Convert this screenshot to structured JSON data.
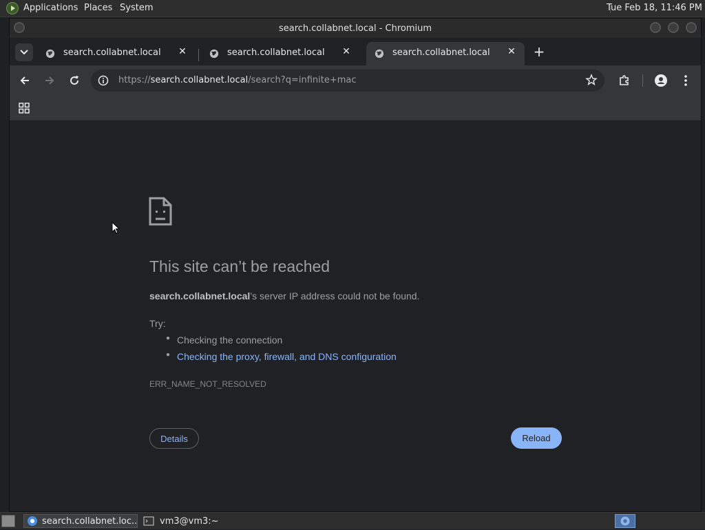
{
  "top_panel": {
    "menus": [
      "Applications",
      "Places",
      "System"
    ],
    "clock": "Tue Feb 18, 11:46 PM"
  },
  "window": {
    "title": "search.collabnet.local - Chromium"
  },
  "tabs": [
    {
      "title": "search.collabnet.local",
      "close": "✕",
      "active": false
    },
    {
      "title": "search.collabnet.local",
      "close": "✕",
      "active": false
    },
    {
      "title": "search.collabnet.local",
      "close": "✕",
      "active": true
    }
  ],
  "new_tab": "+",
  "omnibox": {
    "scheme": "https://",
    "host": "search.collabnet.local",
    "path": "/search?q=infinite+mac"
  },
  "error_page": {
    "title": "This site can’t be reached",
    "host_bold": "search.collabnet.local",
    "description_rest": "’s server IP address could not be found.",
    "try_label": "Try:",
    "suggestions": [
      {
        "text": "Checking the connection",
        "is_link": false
      },
      {
        "text": "Checking the proxy, firewall, and DNS configuration",
        "is_link": true
      }
    ],
    "error_code": "ERR_NAME_NOT_RESOLVED",
    "details_button": "Details",
    "reload_button": "Reload"
  },
  "taskbar": {
    "tasks": [
      {
        "label": "search.collabnet.loc...",
        "icon": "chromium-icon"
      },
      {
        "label": "vm3@vm3:~",
        "icon": "terminal-icon"
      }
    ]
  },
  "colors": {
    "accent": "#8ab4f8",
    "page_bg": "#202124",
    "toolbar_bg": "#35363a"
  }
}
